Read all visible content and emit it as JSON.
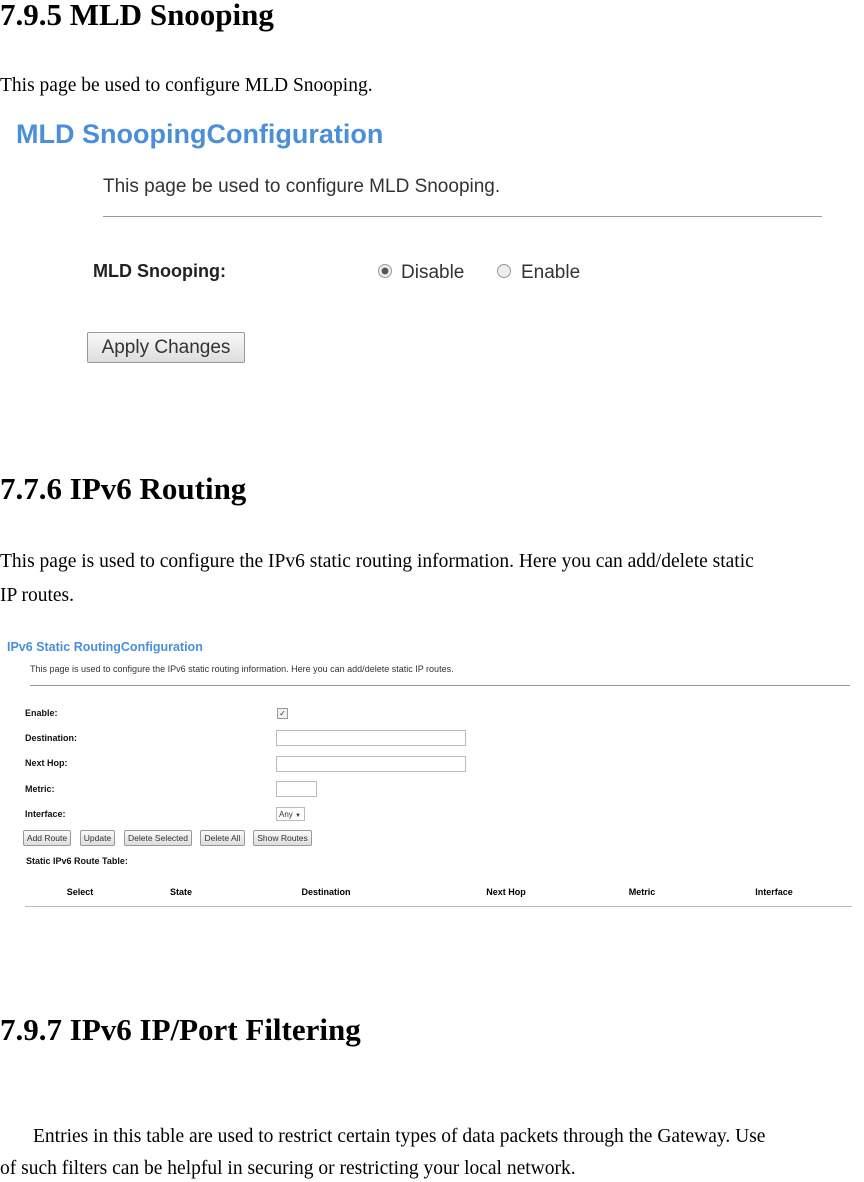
{
  "sections": [
    {
      "heading": "7.9.5 MLD Snooping",
      "paragraph": "This page be used to configure MLD Snooping."
    },
    {
      "heading": "7.7.6 IPv6 Routing",
      "paragraph_lines": [
        "This page is used to configure the IPv6 static routing information. Here you can add/delete static",
        "IP routes."
      ]
    },
    {
      "heading": "7.9.7 IPv6 IP/Port Filtering",
      "paragraph_lines": [
        "Entries in this table are used to restrict certain types of data packets through the Gateway. Use",
        "of such filters can be helpful in securing or restricting your local network."
      ]
    }
  ],
  "mld": {
    "title": "MLD SnoopingConfiguration",
    "description": "This page be used to configure MLD Snooping.",
    "label": "MLD Snooping:",
    "options": [
      "Disable",
      "Enable"
    ],
    "selected": "Disable",
    "apply": "Apply Changes"
  },
  "ipv6": {
    "title": "IPv6 Static RoutingConfiguration",
    "description": "This page is used to configure the IPv6 static routing information. Here you can add/delete static IP routes.",
    "labels": {
      "enable": "Enable:",
      "destination": "Destination:",
      "next_hop": "Next Hop:",
      "metric": "Metric:",
      "interface": "Interface:"
    },
    "enable_checked": true,
    "destination": "",
    "next_hop": "",
    "metric": "",
    "interface_value": "Any",
    "buttons": [
      "Add Route",
      "Update",
      "Delete Selected",
      "Delete All",
      "Show Routes"
    ],
    "table_title": "Static IPv6 Route Table:",
    "columns": [
      "Select",
      "State",
      "Destination",
      "Next Hop",
      "Metric",
      "Interface"
    ]
  },
  "colors": {
    "accent": "#4a8fd8"
  }
}
